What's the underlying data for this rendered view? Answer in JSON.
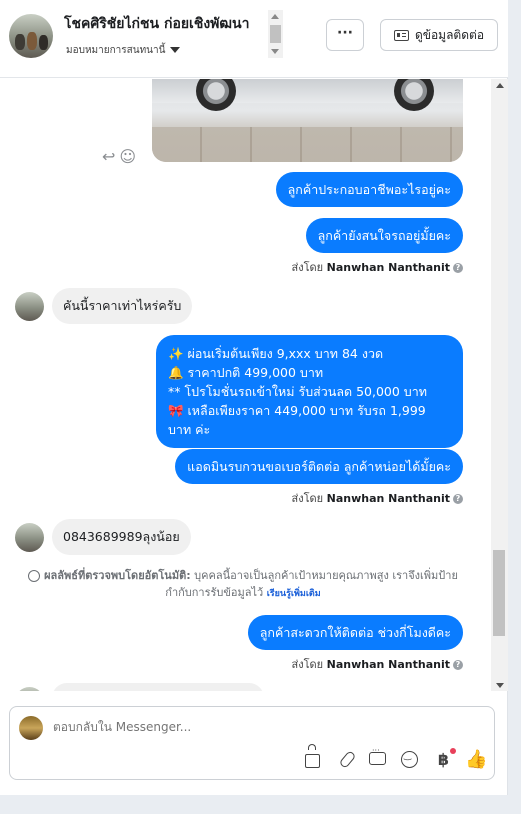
{
  "header": {
    "name": "โชคศิริชัยไก่ชน ก่อยเชิงพัฒนา",
    "assignee": "มอบหมายการสนทนานี้",
    "more_label": "···",
    "contact_label": "ดูข้อมูลติดต่อ"
  },
  "messages": {
    "out1": "ลูกค้าประกอบอาชีพอะไรอยู่คะ",
    "out2": "ลูกค้ายังสนใจรถอยู่มั้ยคะ",
    "sent_by_prefix": "ส่งโดย",
    "sent_by_name": "Nanwhan Nanthanit",
    "in1": "คันนี้ราคาเท่าไหร่ครับ",
    "promo_lines": [
      "✨  ผ่อนเริ่มต้นเพียง 9,xxx บาท  84 งวด",
      "🔔  ราคาปกติ 499,000 บาท",
      "** โปรโมชั่นรถเข้าใหม่ รับส่วนลด 50,000 บาท",
      "🎀  เหลือเพียงราคา 449,000 บาท รับรถ 1,999",
      "บาท  ค่ะ"
    ],
    "out4": "แอดมินรบกวนขอเบอร์ติดต่อ ลูกค้าหน่อยได้มั้ยคะ",
    "in2": "0843689989ลุงน้อย",
    "auto_title": "ผลลัพธ์ที่ตรวจพบโดยอัตโนมัติ:",
    "auto_text": "บุคคลนี้อาจเป็นลูกค้าเป้าหมายคุณภาพสูง เราจึงเพิ่มป้ายกำกับการรับข้อมูลไว้",
    "auto_link": "เรียนรู้เพิ่มเติม",
    "out5": "ลูกค้าสะดวกให้ติดต่อ ช่วงกี่โมงดีคะ"
  },
  "composer": {
    "placeholder": "ตอบกลับใน Messenger..."
  },
  "icons": {
    "reply": "reply-icon",
    "react": "smile-icon",
    "info": "info-icon",
    "sparkle": "sparkle-icon"
  },
  "colors": {
    "outgoing_bubble": "#0a7cff",
    "incoming_bubble": "#f0f0f0",
    "link": "#1a5fd8"
  }
}
